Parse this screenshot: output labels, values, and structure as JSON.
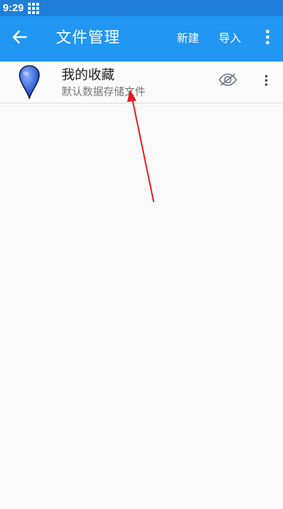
{
  "status_bar": {
    "time": "9:29",
    "icon": "grid-icon"
  },
  "app_bar": {
    "back_icon": "arrow-left-icon",
    "title": "文件管理",
    "actions": {
      "new_label": "新建",
      "import_label": "导入"
    },
    "overflow_icon": "more-vertical-icon"
  },
  "files": [
    {
      "icon": "map-pin-icon",
      "title": "我的收藏",
      "subtitle": "默认数据存储文件",
      "visibility_icon": "eye-off-icon",
      "menu_icon": "more-vertical-icon"
    }
  ],
  "colors": {
    "app_bar": "#2196f3",
    "status_bar": "#1f7fd8",
    "background": "#fafafa",
    "pin": "#3f6de0",
    "annotation": "#e8191e"
  }
}
